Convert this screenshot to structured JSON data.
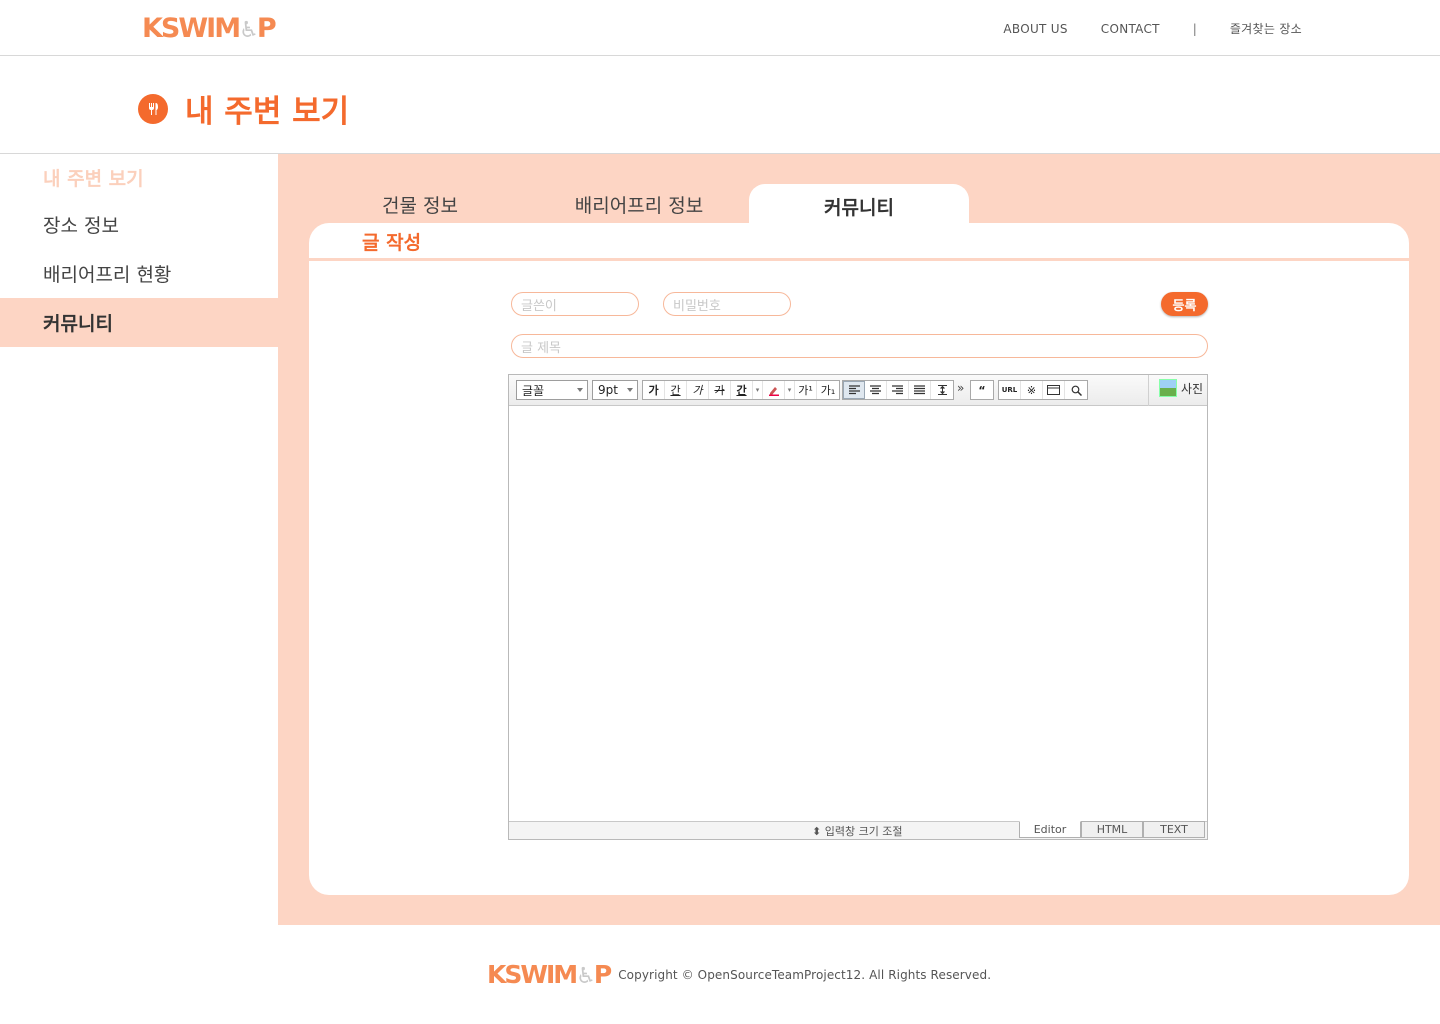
{
  "brand": {
    "logo": "kswimap",
    "accent": "#f46a2d",
    "panel": "#fdd5c4"
  },
  "nav": {
    "about": "ABOUT US",
    "contact": "CONTACT",
    "sep": "|",
    "favorites": "즐겨찾는 장소"
  },
  "page": {
    "title": "내 주변 보기",
    "icon": "fork-knife-icon"
  },
  "sidebar": {
    "items": [
      {
        "label": "내 주변 보기"
      },
      {
        "label": "장소 정보"
      },
      {
        "label": "배리어프리 현황"
      },
      {
        "label": "커뮤니티"
      }
    ]
  },
  "tabs": [
    {
      "label": "건물 정보"
    },
    {
      "label": "배리어프리 정보"
    },
    {
      "label": "커뮤니티"
    }
  ],
  "form": {
    "heading": "글 작성",
    "author_placeholder": "글쓴이",
    "password_placeholder": "비밀번호",
    "title_placeholder": "글 제목",
    "submit": "등록"
  },
  "editor": {
    "font": "글꼴",
    "size": "9pt",
    "format_buttons": [
      "가",
      "간",
      "가",
      "가",
      "간"
    ],
    "script_buttons": [
      "가¹",
      "가₁"
    ],
    "more": "»",
    "photo": "사진",
    "resize": "⬍ 입력창 크기 조절",
    "modes": [
      "Editor",
      "HTML",
      "TEXT"
    ]
  },
  "footer": {
    "copyright": "Copyright © OpenSourceTeamProject12. All Rights Reserved."
  }
}
